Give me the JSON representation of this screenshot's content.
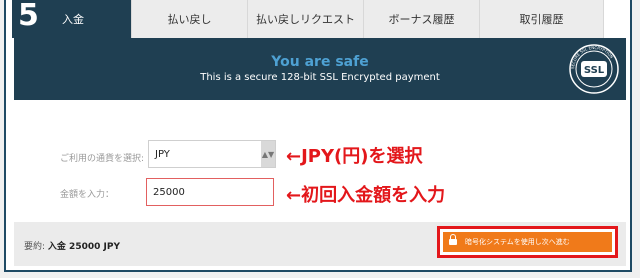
{
  "step": "5",
  "tabs": [
    {
      "label": "入金",
      "active": true
    },
    {
      "label": "払い戻し",
      "active": false
    },
    {
      "label": "払い戻しリクエスト",
      "active": false
    },
    {
      "label": "ボーナス履歴",
      "active": false
    },
    {
      "label": "取引履歴",
      "active": false
    }
  ],
  "banner": {
    "title": "You are safe",
    "subtitle": "This is a secure 128-bit SSL Encrypted payment",
    "badge_text": "SSL",
    "badge_ring": "SECURE SSL ENCRYPTION"
  },
  "form": {
    "currency_label": "ご利用の通貨を選択:",
    "currency_value": "JPY",
    "amount_label": "金額を入力：",
    "amount_value": "25000"
  },
  "annotations": {
    "currency": "←JPY(円)を選択",
    "amount": "←初回入金額を入力"
  },
  "footer": {
    "summary_prefix": "要約:",
    "summary_value": "入金 25000 JPY",
    "pay_button": "暗号化システムを使用し次へ進む"
  },
  "colors": {
    "header_bg": "#1f3f52",
    "accent_blue": "#4ea1d3",
    "orange": "#f07a1a",
    "annotation_red": "#e3171b"
  }
}
